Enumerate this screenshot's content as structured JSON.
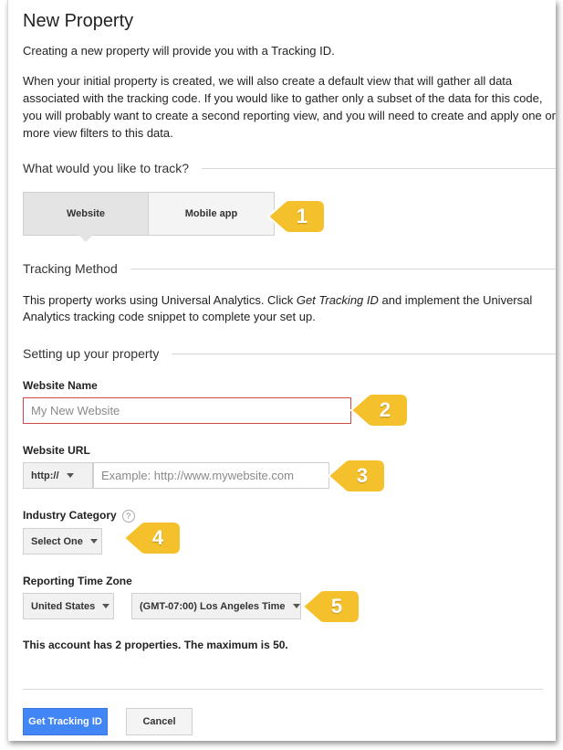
{
  "header": {
    "title": "New Property",
    "intro": "Creating a new property will provide you with a Tracking ID.",
    "description_lines": [
      "When your initial property is created, we will also create a default view that will gather all data",
      "associated with the tracking code. If you would like to gather only a subset of the data for this code,",
      "you will probably want to create a second reporting view, and you will need to create and apply one or",
      "more view filters to this data."
    ]
  },
  "track": {
    "heading": "What would you like to track?",
    "options": [
      "Website",
      "Mobile app"
    ],
    "selected": "Website"
  },
  "tracking_method": {
    "heading": "Tracking Method",
    "line1_pre": "This property works using Universal Analytics. Click ",
    "line1_em": "Get Tracking ID",
    "line1_post": " and implement the Universal",
    "line2": "Analytics tracking code snippet to complete your set up."
  },
  "setup": {
    "heading": "Setting up your property",
    "website_name": {
      "label": "Website Name",
      "placeholder": "My New Website",
      "value": ""
    },
    "website_url": {
      "label": "Website URL",
      "protocol": "http://",
      "placeholder": "Example: http://www.mywebsite.com",
      "value": ""
    },
    "industry": {
      "label": "Industry Category",
      "help": "?",
      "selected": "Select One"
    },
    "timezone": {
      "label": "Reporting Time Zone",
      "country": "United States",
      "zone": "(GMT-07:00) Los Angeles Time"
    },
    "summary": "This account has 2 properties. The maximum is 50."
  },
  "actions": {
    "primary": "Get Tracking ID",
    "secondary": "Cancel"
  },
  "callouts": [
    "1",
    "2",
    "3",
    "4",
    "5"
  ],
  "colors": {
    "accent": "#4285f4",
    "callout": "#f4c12c",
    "error_border": "#d04a4a"
  }
}
